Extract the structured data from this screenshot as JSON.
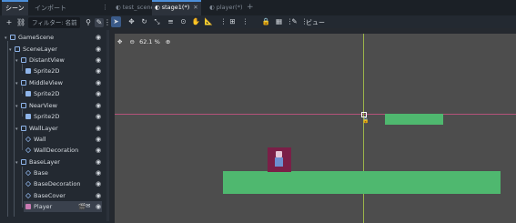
{
  "left_dock": {
    "tabs": [
      {
        "label": "シーン",
        "active": true
      },
      {
        "label": "インポート",
        "active": false
      }
    ],
    "filter_placeholder": "フィルター: 名前",
    "tree": [
      {
        "label": "GameScene",
        "icon": "node-icon",
        "depth": 0,
        "expanded": true
      },
      {
        "label": "SceneLayer",
        "icon": "node-icon",
        "depth": 1,
        "expanded": true
      },
      {
        "label": "DistantView",
        "icon": "node-icon",
        "depth": 2,
        "expanded": true
      },
      {
        "label": "Sprite2D",
        "icon": "sprite-icon",
        "depth": 3
      },
      {
        "label": "MiddleView",
        "icon": "node-icon",
        "depth": 2,
        "expanded": true
      },
      {
        "label": "Sprite2D",
        "icon": "sprite-icon",
        "depth": 3
      },
      {
        "label": "NearView",
        "icon": "node-icon",
        "depth": 2,
        "expanded": true
      },
      {
        "label": "Sprite2D",
        "icon": "sprite-icon",
        "depth": 3
      },
      {
        "label": "WallLayer",
        "icon": "node-icon",
        "depth": 2,
        "expanded": true
      },
      {
        "label": "Wall",
        "icon": "tilemap-icon",
        "depth": 3
      },
      {
        "label": "WallDecoration",
        "icon": "tilemap-icon",
        "depth": 3
      },
      {
        "label": "BaseLayer",
        "icon": "node-icon",
        "depth": 2,
        "expanded": true
      },
      {
        "label": "Base",
        "icon": "tilemap-icon",
        "depth": 3
      },
      {
        "label": "BaseDecoration",
        "icon": "tilemap-icon",
        "depth": 3
      },
      {
        "label": "BaseCover",
        "icon": "tilemap-icon",
        "depth": 3
      },
      {
        "label": "Player",
        "icon": "character-icon",
        "depth": 3,
        "selected": true
      }
    ]
  },
  "scene_tabs": [
    {
      "label": "test_scene",
      "active": false
    },
    {
      "label": "stage1(*)",
      "active": true
    },
    {
      "label": "player(*)",
      "active": false
    }
  ],
  "editor": {
    "view_menu": "ビュー",
    "zoom": "62.1 %"
  },
  "colors": {
    "platform": "#4fb86f",
    "viewport_bg": "#4d4d4d",
    "accent": "#4c8fd9"
  }
}
